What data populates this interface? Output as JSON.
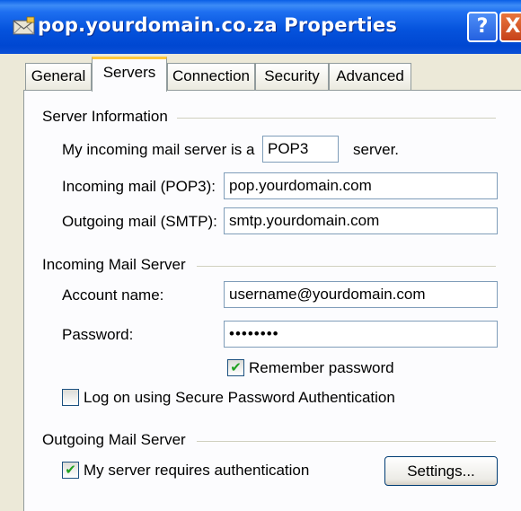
{
  "window": {
    "title": "pop.yourdomain.co.za Properties",
    "help_glyph": "?",
    "close_glyph": "X",
    "icon": "mail-envelope-icon"
  },
  "tabs": [
    {
      "label": "General",
      "active": false
    },
    {
      "label": "Servers",
      "active": true
    },
    {
      "label": "Connection",
      "active": false
    },
    {
      "label": "Security",
      "active": false
    },
    {
      "label": "Advanced",
      "active": false
    }
  ],
  "server_info": {
    "heading": "Server Information",
    "server_type_prefix": "My incoming mail server is a",
    "server_type_value": "POP3",
    "server_type_suffix": "server.",
    "incoming_label": "Incoming mail (POP3):",
    "incoming_value": "pop.yourdomain.com",
    "outgoing_label": "Outgoing mail (SMTP):",
    "outgoing_value": "smtp.yourdomain.com"
  },
  "incoming_server": {
    "heading": "Incoming Mail Server",
    "account_label": "Account name:",
    "account_value": "username@yourdomain.com",
    "password_label": "Password:",
    "password_value": "••••••••",
    "remember_label": "Remember password",
    "remember_checked": true,
    "spa_label": "Log on using Secure Password Authentication",
    "spa_checked": false
  },
  "outgoing_server": {
    "heading": "Outgoing Mail Server",
    "auth_label": "My server requires authentication",
    "auth_checked": true,
    "settings_button": "Settings..."
  },
  "colors": {
    "titlebar": "#0553dd",
    "dialog_bg": "#ece9d8",
    "panel_bg": "#fcfcfe",
    "active_tab_accent": "#ffc83c",
    "check_mark": "#21a121"
  }
}
